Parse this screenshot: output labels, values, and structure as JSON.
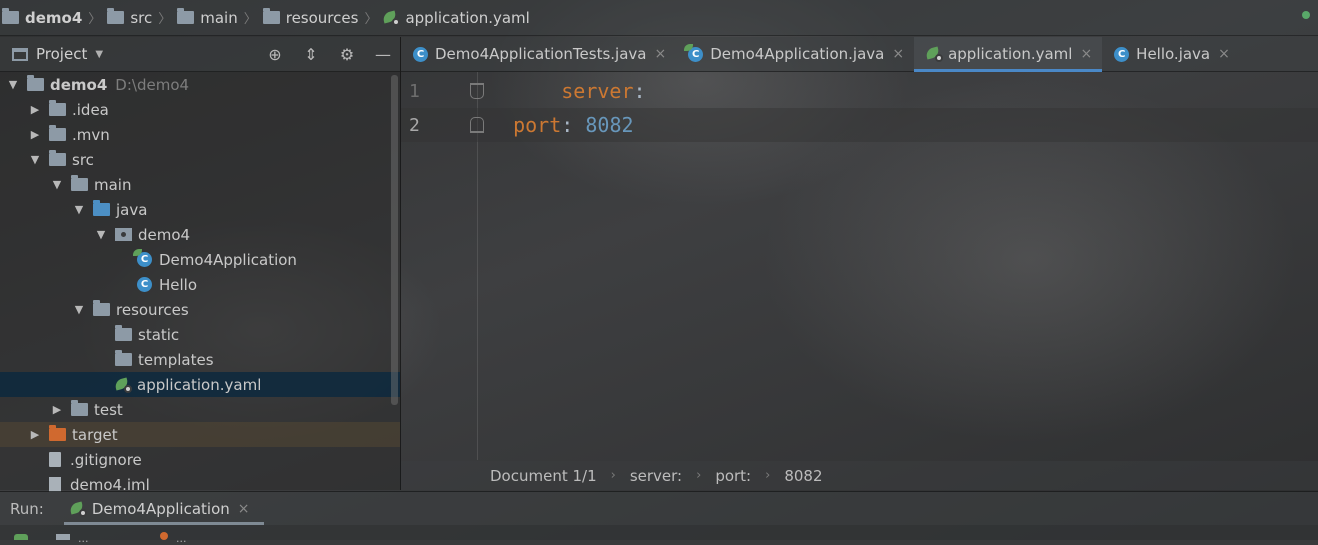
{
  "breadcrumb": [
    {
      "label": "demo4",
      "icon": "module-folder-icon"
    },
    {
      "label": "src",
      "icon": "folder-icon"
    },
    {
      "label": "main",
      "icon": "folder-icon"
    },
    {
      "label": "resources",
      "icon": "resources-folder-icon"
    },
    {
      "label": "application.yaml",
      "icon": "spring-yaml-icon"
    }
  ],
  "project_panel": {
    "title": "Project",
    "tools": [
      "locate-icon",
      "collapse-all-icon",
      "gear-icon",
      "minimize-icon"
    ],
    "tree": [
      {
        "label": "demo4",
        "extra": "D:\\demo4",
        "depth": 0,
        "arrow": "down",
        "icon": "module-folder-icon"
      },
      {
        "label": ".idea",
        "depth": 1,
        "arrow": "right",
        "icon": "folder-icon"
      },
      {
        "label": ".mvn",
        "depth": 1,
        "arrow": "right",
        "icon": "folder-icon"
      },
      {
        "label": "src",
        "depth": 1,
        "arrow": "down",
        "icon": "folder-icon"
      },
      {
        "label": "main",
        "depth": 2,
        "arrow": "down",
        "icon": "folder-icon"
      },
      {
        "label": "java",
        "depth": 3,
        "arrow": "down",
        "icon": "source-folder-icon"
      },
      {
        "label": "demo4",
        "depth": 4,
        "arrow": "down",
        "icon": "package-icon"
      },
      {
        "label": "Demo4Application",
        "depth": 5,
        "arrow": "none",
        "icon": "spring-class-icon"
      },
      {
        "label": "Hello",
        "depth": 5,
        "arrow": "none",
        "icon": "class-icon"
      },
      {
        "label": "resources",
        "depth": 3,
        "arrow": "down",
        "icon": "resources-folder-icon"
      },
      {
        "label": "static",
        "depth": 4,
        "arrow": "none",
        "icon": "folder-icon"
      },
      {
        "label": "templates",
        "depth": 4,
        "arrow": "none",
        "icon": "folder-icon"
      },
      {
        "label": "application.yaml",
        "depth": 4,
        "arrow": "none",
        "icon": "spring-yaml-icon",
        "selected": true
      },
      {
        "label": "test",
        "depth": 2,
        "arrow": "right",
        "icon": "folder-icon"
      },
      {
        "label": "target",
        "depth": 1,
        "arrow": "right",
        "icon": "excluded-folder-icon",
        "excluded": true
      },
      {
        "label": ".gitignore",
        "depth": 1,
        "arrow": "none",
        "icon": "ignore-file-icon"
      },
      {
        "label": "demo4.iml",
        "depth": 1,
        "arrow": "none",
        "icon": "iml-file-icon"
      }
    ]
  },
  "editor_tabs": [
    {
      "label": "Demo4ApplicationTests.java",
      "icon": "class-icon",
      "active": false
    },
    {
      "label": "Demo4Application.java",
      "icon": "spring-class-icon",
      "active": false
    },
    {
      "label": "application.yaml",
      "icon": "spring-yaml-icon",
      "active": true
    },
    {
      "label": "Hello.java",
      "icon": "class-icon",
      "active": false
    }
  ],
  "tab_close_glyph": "×",
  "editor": {
    "lines": [
      {
        "number": "1",
        "key": "server",
        "punct": ":",
        "value": ""
      },
      {
        "number": "2",
        "key": "port",
        "punct": ":",
        "value": "8082"
      }
    ],
    "current_line": 2
  },
  "editor_status": [
    "Document 1/1",
    "server:",
    "port:",
    "8082"
  ],
  "run_bar": {
    "label": "Run:",
    "tab_label": "Demo4Application"
  },
  "colors": {
    "selection": "#0d293e",
    "keyword": "#cc7832",
    "number": "#6897bb",
    "accent": "#4a88c7"
  }
}
